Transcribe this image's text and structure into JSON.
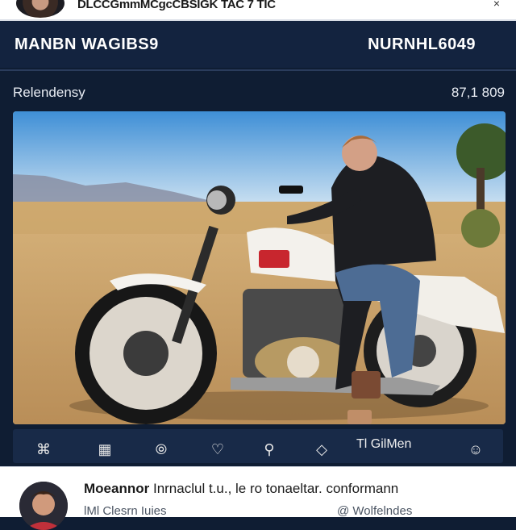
{
  "top_bar": {
    "text": "DLCCGmmMCgcCBSIGK TAC 7 TIC",
    "close_glyph": "×"
  },
  "header": {
    "brand": "MANBN WAGIBS9",
    "code": "NURNHL6049"
  },
  "subheader": {
    "label": "Relendensy",
    "count": "87,1 809"
  },
  "photo": {
    "description_icon": "motorcycle-photo"
  },
  "actions": {
    "items": [
      {
        "name": "share-icon",
        "glyph": "⌘"
      },
      {
        "name": "gallery-icon",
        "glyph": "▦"
      },
      {
        "name": "tag-icon",
        "glyph": "⦾"
      },
      {
        "name": "like-icon",
        "glyph": "♡"
      },
      {
        "name": "location-icon",
        "glyph": "⚲"
      },
      {
        "name": "diamond-icon",
        "glyph": "◇"
      },
      {
        "name": "emoji-icon",
        "glyph": "☺"
      }
    ],
    "label": "Tl GilMen"
  },
  "post": {
    "author": "Moeannor",
    "caption": "Inrnaclul t.u., le ro tonaeltar. conformann",
    "meta_left": "lMl  Clesrn  Iuies",
    "meta_right": "@ Wolfelndes"
  },
  "colors": {
    "header_bg": "#13233f",
    "page_bg": "#0f1d33",
    "text_light": "#ffffff"
  }
}
